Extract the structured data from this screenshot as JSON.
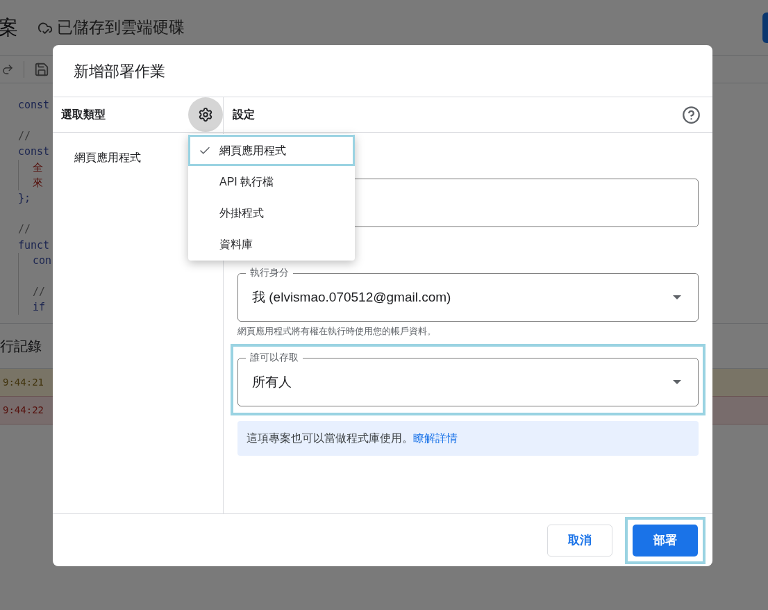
{
  "background": {
    "title_fragment": "案",
    "save_status": "已儲存到雲端硬碟",
    "code_blocks": [
      {
        "lines": [
          {
            "text": "const",
            "kind": "keyword"
          }
        ]
      },
      {
        "lines": [
          {
            "text": "//",
            "kind": "comment"
          },
          {
            "text": "const",
            "kind": "keyword",
            "children": [
              {
                "lines": [
                  {
                    "text": "全",
                    "kind": "string"
                  },
                  {
                    "text": "來",
                    "kind": "string"
                  }
                ]
              }
            ]
          },
          {
            "text": "};",
            "kind": "keyword"
          }
        ]
      },
      {
        "lines": [
          {
            "text": "//",
            "kind": "comment"
          },
          {
            "text": "funct",
            "kind": "keyword",
            "children": [
              {
                "lines": [
                  {
                    "text": "con",
                    "kind": "keyword"
                  }
                ]
              },
              {
                "lines": [
                  {
                    "text": "//",
                    "kind": "comment"
                  },
                  {
                    "text": "if",
                    "kind": "keyword"
                  }
                ]
              }
            ]
          }
        ]
      }
    ],
    "log_title": "行記錄",
    "log_rows": [
      {
        "time": "9:44:21",
        "kind": "warning"
      },
      {
        "time": "9:44:22",
        "kind": "error"
      }
    ]
  },
  "dialog": {
    "title": "新增部署作業",
    "type_header": "選取類型",
    "types": [
      {
        "label": "網頁應用程式"
      }
    ],
    "settings_header": "設定",
    "menu": [
      {
        "label": "網頁應用程式",
        "selected": true,
        "highlighted": true
      },
      {
        "label": "API 執行檔",
        "selected": false,
        "highlighted": false
      },
      {
        "label": "外掛程式",
        "selected": false,
        "highlighted": false
      },
      {
        "label": "資料庫",
        "selected": false,
        "highlighted": false
      }
    ],
    "fields": [
      {
        "kind": "text",
        "highlighted": false
      },
      {
        "kind": "select",
        "label": "執行身分",
        "value": "我 (elvismao.070512@gmail.com)",
        "helper": "網頁應用程式將有權在執行時使用您的帳戶資料。",
        "highlighted": false
      },
      {
        "kind": "select",
        "label": "誰可以存取",
        "value": "所有人",
        "highlighted": true
      }
    ],
    "info": {
      "text": "這項專案也可以當做程式庫使用。",
      "link": "瞭解詳情"
    },
    "buttons": [
      {
        "label": "取消",
        "kind": "secondary",
        "highlighted": false
      },
      {
        "label": "部署",
        "kind": "primary",
        "highlighted": true
      }
    ]
  }
}
